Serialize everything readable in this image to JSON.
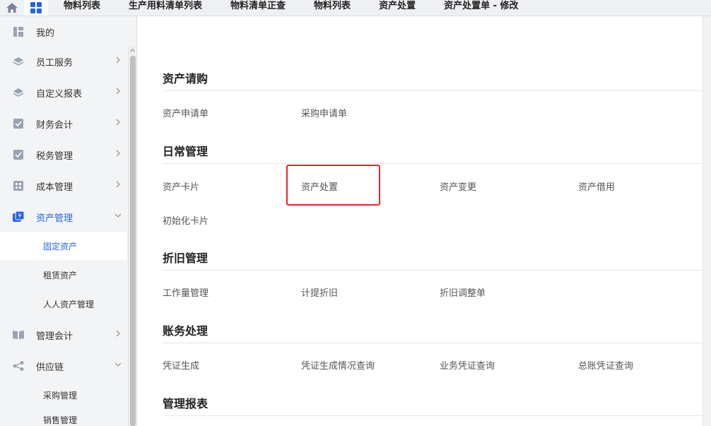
{
  "top_tabs": [
    "物料列表",
    "生产用料清单列表",
    "物料清单正查",
    "物料列表",
    "资产处置",
    "资产处置单 - 修改"
  ],
  "sidebar": {
    "items": [
      {
        "label": "我的",
        "icon": "dashboard-icon"
      },
      {
        "label": "员工服务",
        "icon": "layers-icon"
      },
      {
        "label": "自定义报表",
        "icon": "layers-icon"
      },
      {
        "label": "财务会计",
        "icon": "checklist-icon"
      },
      {
        "label": "税务管理",
        "icon": "checklist-icon"
      },
      {
        "label": "成本管理",
        "icon": "grid-icon"
      },
      {
        "label": "资产管理",
        "icon": "yen-asset-icon"
      },
      {
        "label": "管理会计",
        "icon": "book-icon"
      },
      {
        "label": "供应链",
        "icon": "share-icon"
      }
    ],
    "asset_sub": [
      "固定资产",
      "租赁资产",
      "人人资产管理"
    ],
    "supply_sub": [
      "采购管理",
      "销售管理"
    ]
  },
  "sections": [
    {
      "title": "资产请购",
      "links": [
        "资产申请单",
        "采购申请单"
      ]
    },
    {
      "title": "日常管理",
      "links": [
        "资产卡片",
        "资产处置",
        "资产变更",
        "资产借用",
        "初始化卡片"
      ]
    },
    {
      "title": "折旧管理",
      "links": [
        "工作量管理",
        "计提折旧",
        "折旧调整单"
      ]
    },
    {
      "title": "账务处理",
      "links": [
        "凭证生成",
        "凭证生成情况查询",
        "业务凭证查询",
        "总账凭证查询"
      ]
    },
    {
      "title": "管理报表",
      "links": []
    }
  ],
  "colors": {
    "accent": "#2563eb",
    "highlight": "#e5252a",
    "sidebar_bg": "#f3f4f6"
  }
}
